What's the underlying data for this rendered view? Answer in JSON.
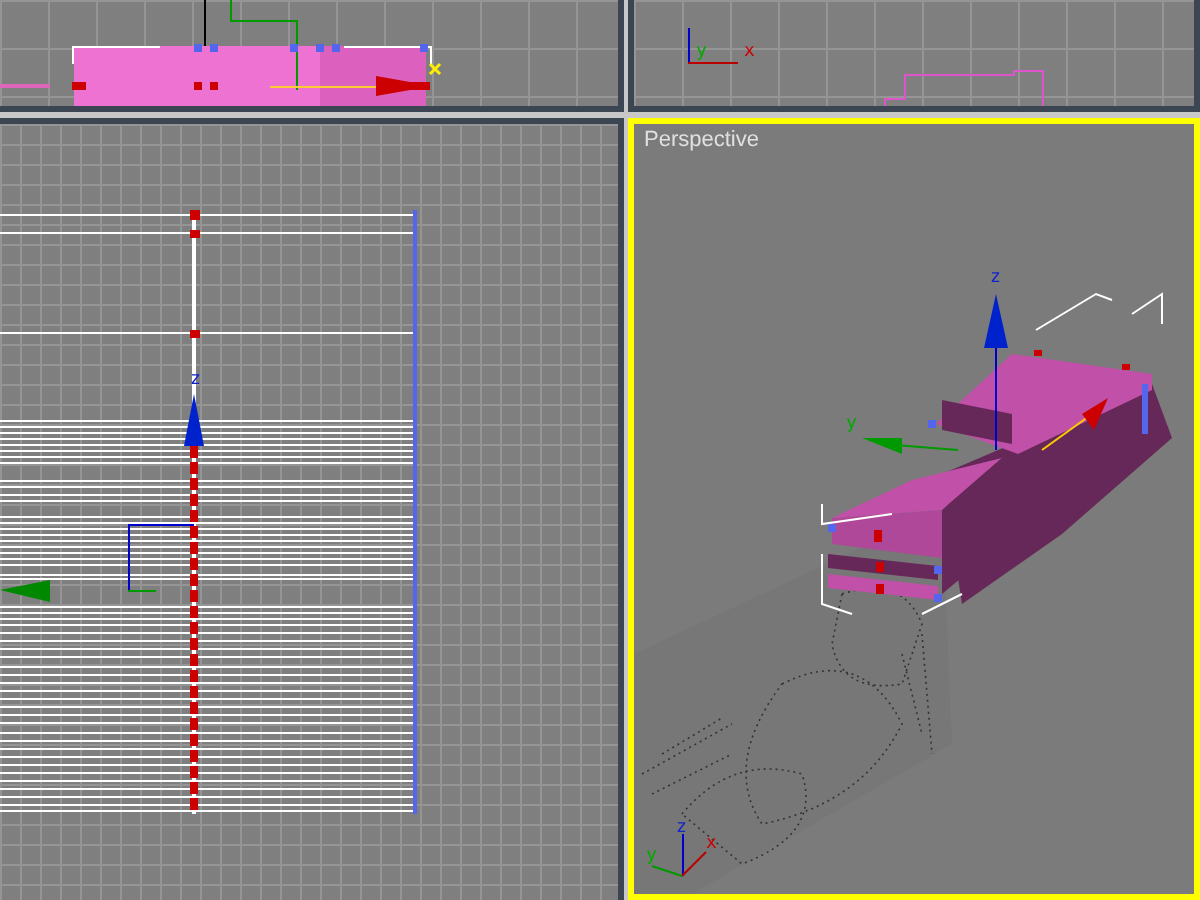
{
  "viewports": [
    {
      "kind": "top",
      "active": false
    },
    {
      "kind": "front",
      "active": false,
      "axis_labels": [
        "y",
        "x"
      ]
    },
    {
      "kind": "left",
      "active": false,
      "axis_labels": [
        "z"
      ]
    },
    {
      "kind": "perspective",
      "label": "Perspective",
      "active": true,
      "gizmo_labels": [
        "z",
        "y"
      ],
      "tripod_labels": [
        "z",
        "y",
        "x"
      ]
    }
  ]
}
